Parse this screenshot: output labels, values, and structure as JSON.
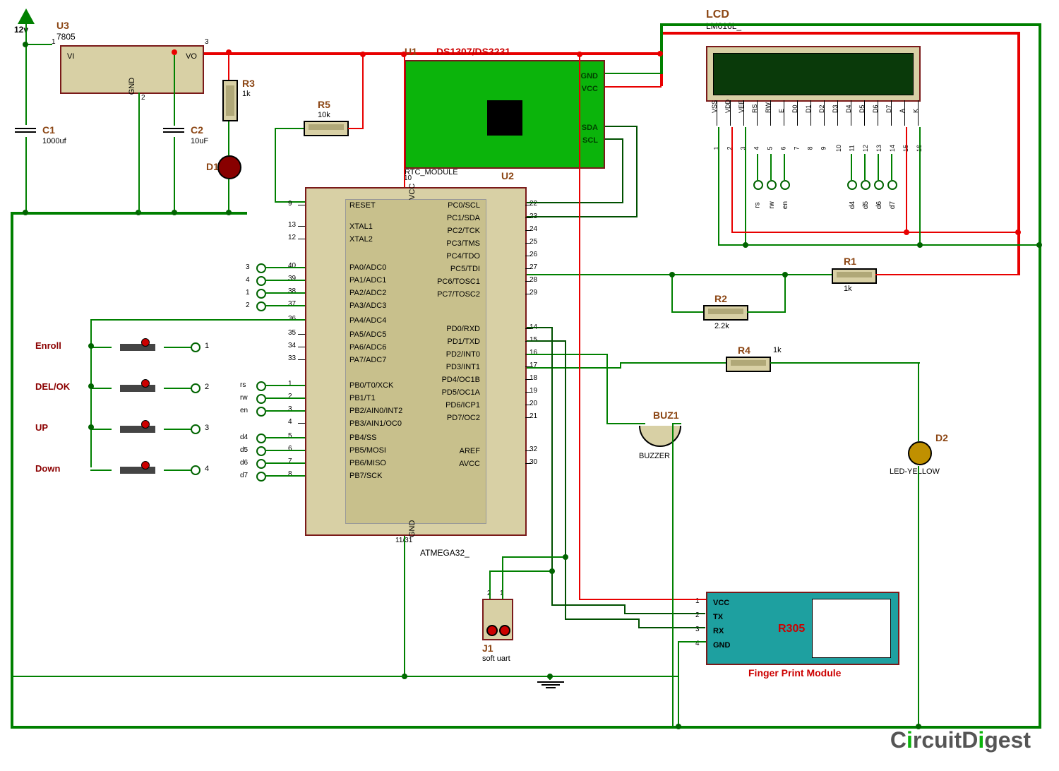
{
  "title_12v": "12v",
  "components": {
    "u3": {
      "ref": "U3",
      "value": "7805",
      "pins": {
        "vi": "VI",
        "vo": "VO",
        "gnd": "GND"
      }
    },
    "c1": {
      "ref": "C1",
      "value": "1000uf"
    },
    "c2": {
      "ref": "C2",
      "value": "10uF"
    },
    "r1": {
      "ref": "R1",
      "value": "1k"
    },
    "r2": {
      "ref": "R2",
      "value": "2.2k"
    },
    "r3": {
      "ref": "R3",
      "value": "1k"
    },
    "r4": {
      "ref": "R4",
      "value": "1k"
    },
    "r5": {
      "ref": "R5",
      "value": "10k"
    },
    "d1": {
      "ref": "D1",
      "value": ""
    },
    "d2": {
      "ref": "D2",
      "value": "LED-YELLOW"
    },
    "u1": {
      "ref": "U1",
      "value": "DS1307/DS3231",
      "sub": "RTC_MODULE",
      "pins": {
        "gnd": "GND",
        "vcc": "VCC",
        "sda": "SDA",
        "scl": "SCL"
      }
    },
    "u2": {
      "ref": "U2",
      "value": "ATMEGA32_"
    },
    "lcd": {
      "ref": "LCD",
      "value": "LM016L_"
    },
    "buz1": {
      "ref": "BUZ1",
      "value": "BUZZER"
    },
    "j1": {
      "ref": "J1",
      "value": "soft uart"
    },
    "fp": {
      "ref": "R305",
      "value": "Finger Print Module",
      "pins": {
        "vcc": "VCC",
        "tx": "TX",
        "rx": "RX",
        "gnd": "GND"
      }
    }
  },
  "buttons": {
    "enroll": "Enroll",
    "delok": "DEL/OK",
    "up": "UP",
    "down": "Down"
  },
  "lcd_pins": {
    "names": [
      "VSS",
      "VDD",
      "VEE",
      "RS",
      "RW",
      "E",
      "D0",
      "D1",
      "D2",
      "D3",
      "D4",
      "D5",
      "D6",
      "D7",
      "A",
      "K"
    ],
    "nums": [
      "1",
      "2",
      "3",
      "4",
      "5",
      "6",
      "7",
      "8",
      "9",
      "10",
      "11",
      "12",
      "13",
      "14",
      "15",
      "16"
    ]
  },
  "lcd_terms": [
    "rs",
    "rw",
    "en",
    "d4",
    "d5",
    "d6",
    "d7"
  ],
  "mcu_pins_left": [
    {
      "n": "9",
      "name": "RESET"
    },
    {
      "n": "13",
      "name": "XTAL1"
    },
    {
      "n": "12",
      "name": "XTAL2"
    },
    {
      "n": "40",
      "name": "PA0/ADC0"
    },
    {
      "n": "39",
      "name": "PA1/ADC1"
    },
    {
      "n": "38",
      "name": "PA2/ADC2"
    },
    {
      "n": "37",
      "name": "PA3/ADC3"
    },
    {
      "n": "36",
      "name": "PA4/ADC4"
    },
    {
      "n": "35",
      "name": "PA5/ADC5"
    },
    {
      "n": "34",
      "name": "PA6/ADC6"
    },
    {
      "n": "33",
      "name": "PA7/ADC7"
    },
    {
      "n": "1",
      "name": "PB0/T0/XCK"
    },
    {
      "n": "2",
      "name": "PB1/T1"
    },
    {
      "n": "3",
      "name": "PB2/AIN0/INT2"
    },
    {
      "n": "4",
      "name": "PB3/AIN1/OC0"
    },
    {
      "n": "5",
      "name": "PB4/SS"
    },
    {
      "n": "6",
      "name": "PB5/MOSI"
    },
    {
      "n": "7",
      "name": "PB6/MISO"
    },
    {
      "n": "8",
      "name": "PB7/SCK"
    }
  ],
  "mcu_pins_right": [
    {
      "n": "22",
      "name": "PC0/SCL"
    },
    {
      "n": "23",
      "name": "PC1/SDA"
    },
    {
      "n": "24",
      "name": "PC2/TCK"
    },
    {
      "n": "25",
      "name": "PC3/TMS"
    },
    {
      "n": "26",
      "name": "PC4/TDO"
    },
    {
      "n": "27",
      "name": "PC5/TDI"
    },
    {
      "n": "28",
      "name": "PC6/TOSC1"
    },
    {
      "n": "29",
      "name": "PC7/TOSC2"
    },
    {
      "n": "14",
      "name": "PD0/RXD"
    },
    {
      "n": "15",
      "name": "PD1/TXD"
    },
    {
      "n": "16",
      "name": "PD2/INT0"
    },
    {
      "n": "17",
      "name": "PD3/INT1"
    },
    {
      "n": "18",
      "name": "PD4/OC1B"
    },
    {
      "n": "19",
      "name": "PD5/OC1A"
    },
    {
      "n": "20",
      "name": "PD6/ICP1"
    },
    {
      "n": "21",
      "name": "PD7/OC2"
    },
    {
      "n": "32",
      "name": "AREF"
    },
    {
      "n": "30",
      "name": "AVCC"
    }
  ],
  "mcu_vcc": "VCC",
  "mcu_gnd": "GND",
  "mcu_vcc_pin": "10",
  "mcu_gnd_pin": "11/31",
  "left_terms": [
    "rs",
    "rw",
    "en",
    "d4",
    "d5",
    "d6",
    "d7"
  ],
  "fp_pin_nums": [
    "1",
    "2",
    "3",
    "4"
  ],
  "button_nums": [
    "1",
    "2",
    "3",
    "4"
  ],
  "pa_terms": [
    "3",
    "4",
    "1",
    "2"
  ],
  "logo": "CircuitDigest"
}
